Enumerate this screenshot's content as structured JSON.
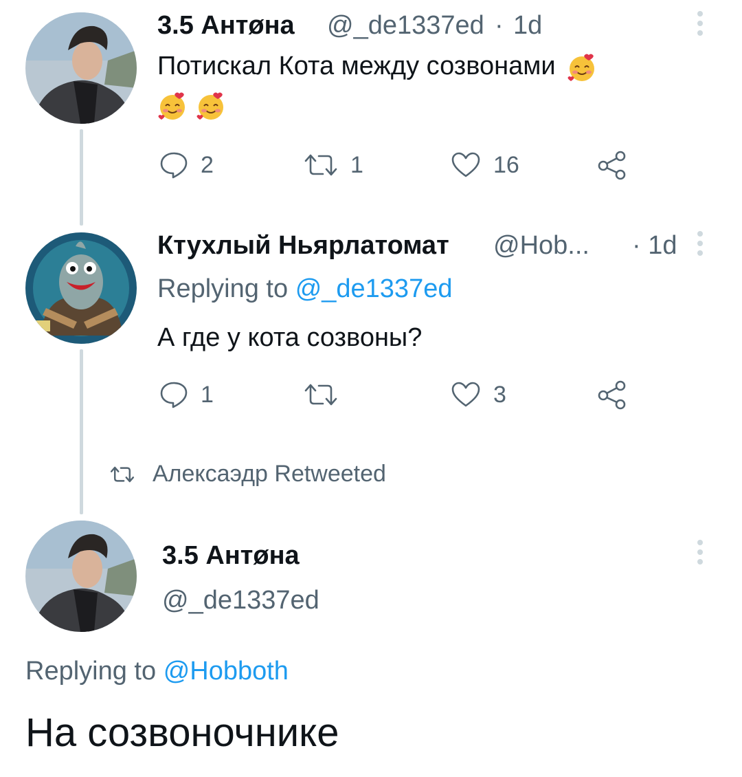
{
  "tweet1": {
    "name": "3.5 Антøна",
    "handle": "@_de1337ed",
    "sep": "·",
    "time": "1d",
    "text": "Потискал Кота между созвонами",
    "emoji": "smiling-face-with-hearts",
    "actions": {
      "replies": "2",
      "retweets": "1",
      "likes": "16"
    }
  },
  "tweet2": {
    "name": "Ктухлый Ньярлатомат",
    "handle": "@Hob...",
    "time": "· 1d",
    "replying_prefix": "Replying to",
    "replying_handle": "@_de1337ed",
    "text": "А где у кота созвоны?",
    "actions": {
      "replies": "1",
      "retweets": "",
      "likes": "3"
    }
  },
  "retweet_notice": "Алексаэдр Retweeted",
  "tweet3": {
    "name": "3.5 Антøна",
    "handle": "@_de1337ed",
    "replying_prefix": "Replying to",
    "replying_handle": "@Hobboth",
    "text": "На созвоночнике"
  },
  "colors": {
    "link": "#1d9bf0",
    "secondary": "#536471",
    "line": "#cfd9de",
    "text": "#0f1419"
  }
}
